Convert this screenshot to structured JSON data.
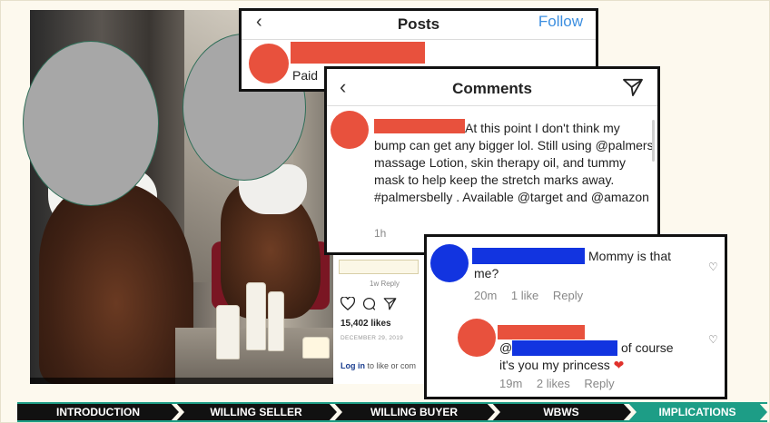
{
  "posts_panel": {
    "back_glyph": "‹",
    "title": "Posts",
    "follow_label": "Follow",
    "paid_text": "Paid",
    "more_glyph": "..."
  },
  "comments_panel": {
    "back_glyph": "‹",
    "title": "Comments",
    "comment_text_lead": "At this point I don't think my",
    "comment_text_rest": "bump can get any bigger lol. Still using @palmers massage Lotion, skin therapy oil, and tummy mask to help keep the stretch marks away. #palmersbelly . Available @target and @amazon",
    "time": "1h"
  },
  "instagram_underlay": {
    "reply_hint": "1w   Reply",
    "likes": "15,402 likes",
    "date": "DECEMBER 29, 2019",
    "login_link": "Log in",
    "login_rest": " to like or com"
  },
  "reply_panel": {
    "comment1_lead": "Mommy is that",
    "comment1_rest": "me?",
    "comment1_time": "20m",
    "comment1_likes": "1 like",
    "comment1_reply": "Reply",
    "comment2_at": "@",
    "comment2_lead": "of course",
    "comment2_rest": "it's you my princess",
    "comment2_heart": "❤",
    "comment2_time": "19m",
    "comment2_likes": "2 likes",
    "comment2_reply": "Reply",
    "like_glyph": "♡"
  },
  "nav": {
    "steps": [
      "INTRODUCTION",
      "WILLING SELLER",
      "WILLING BUYER",
      "WBWS",
      "IMPLICATIONS"
    ],
    "active_index": 4
  },
  "colors": {
    "redaction_red": "#e8513d",
    "redaction_blue": "#1234e0",
    "follow_blue": "#3d8fe0",
    "nav_active": "#1d9d86",
    "nav_dark": "#111111"
  }
}
